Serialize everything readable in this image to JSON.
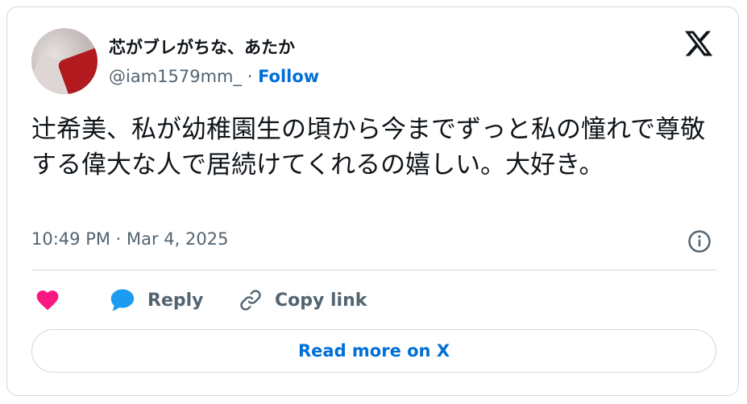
{
  "user": {
    "display_name": "芯がブレがちな、あたか",
    "handle": "@iam1579mm_",
    "separator": " · ",
    "follow_label": "Follow"
  },
  "tweet": {
    "text": "辻希美、私が幼稚園生の頃から今までずっと私の憧れで尊敬する偉大な人で居続けてくれるの嬉しい。大好き。",
    "timestamp": "10:49 PM · Mar 4, 2025"
  },
  "actions": {
    "reply_label": "Reply",
    "copy_link_label": "Copy link"
  },
  "footer": {
    "read_more_label": "Read more on X"
  },
  "colors": {
    "like": "#f91880",
    "reply": "#1d9bf0",
    "link_blue": "#006fd6",
    "muted": "#536471",
    "text": "#0f1419",
    "border": "#cfd9de"
  },
  "icons": [
    "heart-icon",
    "speech-bubble-icon",
    "link-icon",
    "x-logo-icon",
    "info-icon"
  ]
}
